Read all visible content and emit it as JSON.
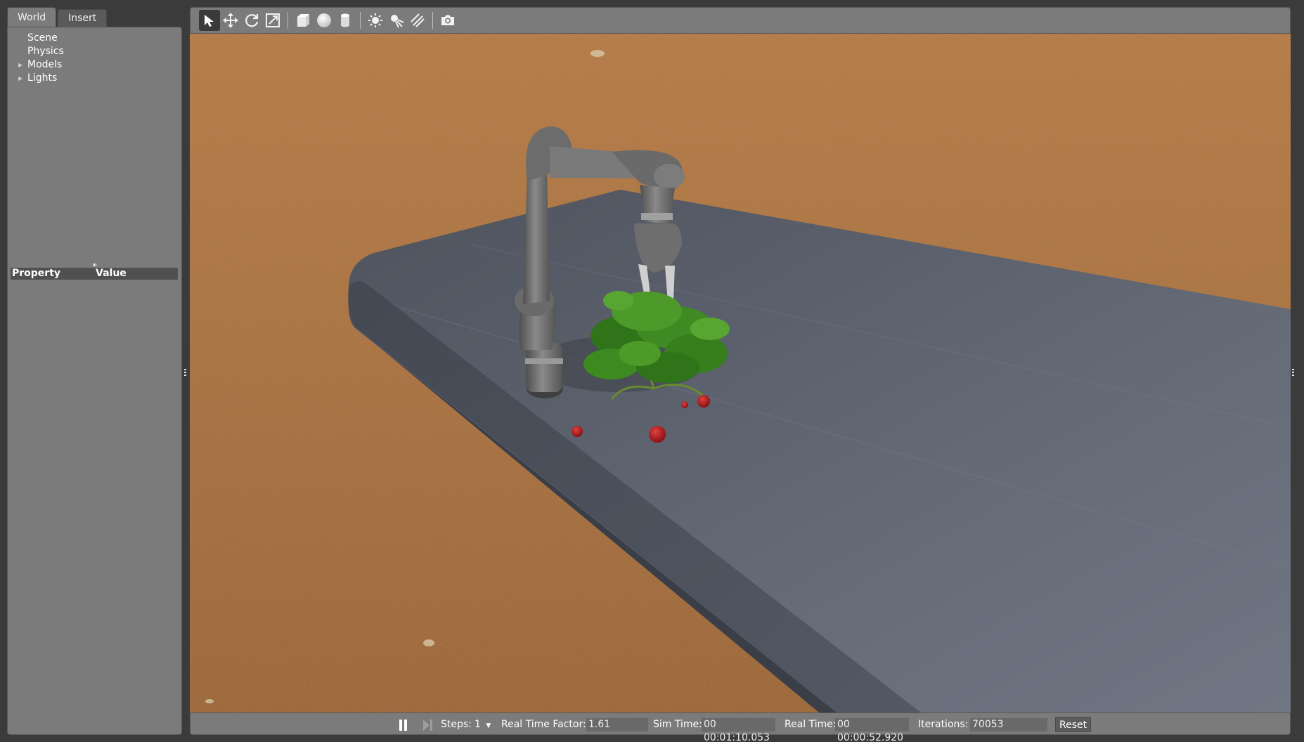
{
  "left_panel": {
    "tabs": [
      {
        "label": "World",
        "active": true
      },
      {
        "label": "Insert",
        "active": false
      }
    ],
    "tree": [
      {
        "label": "Scene",
        "expandable": false
      },
      {
        "label": "Physics",
        "expandable": false
      },
      {
        "label": "Models",
        "expandable": true
      },
      {
        "label": "Lights",
        "expandable": true
      }
    ],
    "property_header": {
      "property": "Property",
      "value": "Value"
    }
  },
  "toolbar": {
    "tools": [
      {
        "icon": "select-arrow-icon",
        "active": true
      },
      {
        "icon": "translate-icon",
        "active": false
      },
      {
        "icon": "rotate-icon",
        "active": false
      },
      {
        "icon": "scale-icon",
        "active": false
      },
      {
        "icon": "box-shape-icon",
        "active": false
      },
      {
        "icon": "sphere-shape-icon",
        "active": false
      },
      {
        "icon": "cylinder-shape-icon",
        "active": false
      },
      {
        "icon": "point-light-icon",
        "active": false
      },
      {
        "icon": "spot-light-icon",
        "active": false
      },
      {
        "icon": "directional-light-icon",
        "active": false
      },
      {
        "icon": "screenshot-camera-icon",
        "active": false
      }
    ]
  },
  "bottom_bar": {
    "steps_label": "Steps:",
    "steps_value": "1",
    "rtf_label": "Real Time Factor:",
    "rtf_value": "1.61",
    "sim_time_label": "Sim Time:",
    "sim_time_value": "00 00:01:10.053",
    "real_time_label": "Real Time:",
    "real_time_value": "00 00:00:52.920",
    "iterations_label": "Iterations:",
    "iterations_value": "70053",
    "reset_label": "Reset"
  },
  "colors": {
    "panel_bg": "#7b7b7b",
    "window_bg": "#3b3b3b",
    "ground": "#a86e3f",
    "table": "#5d6370",
    "robot_arm": "#6f6f6f",
    "leaves": "#3f8a22",
    "strawberry": "#b71c1c"
  }
}
